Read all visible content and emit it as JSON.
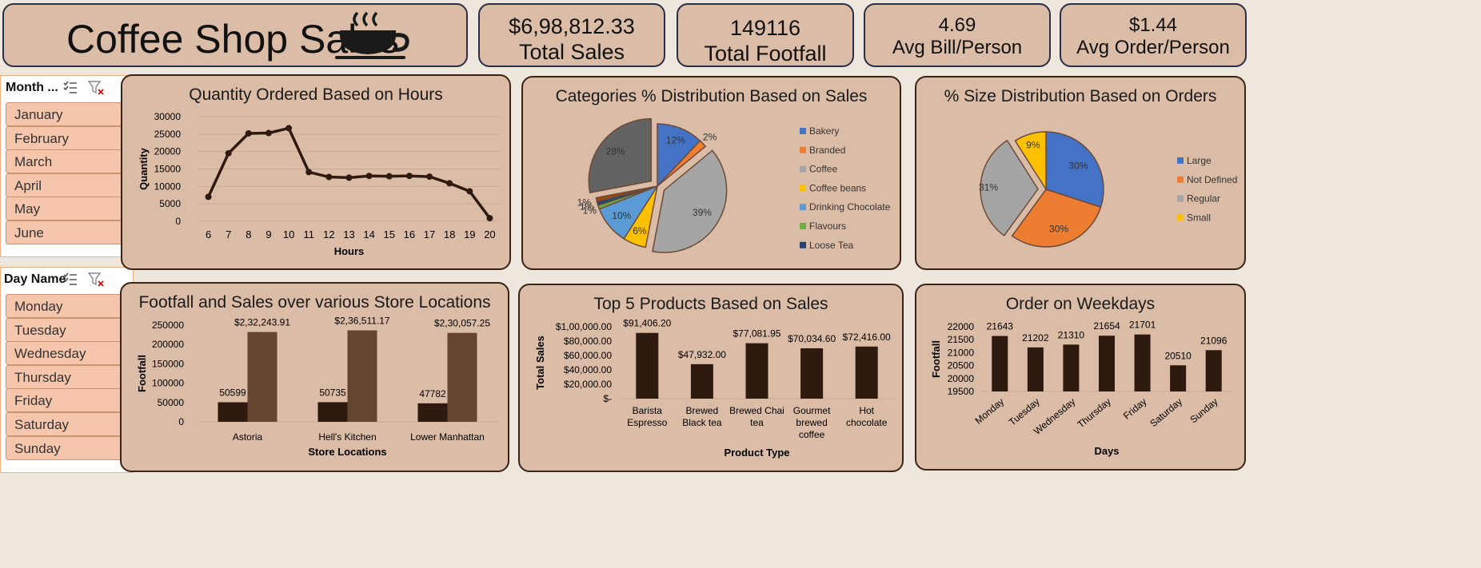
{
  "title": "Coffee Shop Sales",
  "kpis": [
    {
      "value": "$6,98,812.33",
      "label": "Total Sales"
    },
    {
      "value": "149116",
      "label": "Total Footfall"
    },
    {
      "value": "4.69",
      "label": "Avg Bill/Person"
    },
    {
      "value": "$1.44",
      "label": "Avg Order/Person"
    }
  ],
  "slicers": {
    "month": {
      "title": "Month ...",
      "items": [
        "January",
        "February",
        "March",
        "April",
        "May",
        "June"
      ]
    },
    "day": {
      "title": "Day Name",
      "items": [
        "Monday",
        "Tuesday",
        "Wednesday",
        "Thursday",
        "Friday",
        "Saturday",
        "Sunday"
      ]
    }
  },
  "colors": {
    "panel_bg": "#dbbca6",
    "dark_brown": "#2e1a0f",
    "mid_brown": "#634530",
    "line": "#2e1a0f"
  },
  "chart_data": [
    {
      "type": "line",
      "title": "Quantity Ordered Based on Hours",
      "xlabel": "Hours",
      "ylabel": "Quantity",
      "x": [
        6,
        7,
        8,
        9,
        10,
        11,
        12,
        13,
        14,
        15,
        16,
        17,
        18,
        19,
        20
      ],
      "values": [
        7000,
        19500,
        25200,
        25300,
        26700,
        14100,
        12700,
        12500,
        13000,
        12900,
        13000,
        12800,
        10900,
        8600,
        900
      ],
      "ylim": [
        0,
        30000
      ],
      "yticks": [
        "0",
        "5000",
        "10000",
        "15000",
        "20000",
        "25000",
        "30000"
      ],
      "grid": true
    },
    {
      "type": "pie",
      "title": "Categories % Distribution Based on Sales",
      "series": [
        {
          "name": "Bakery",
          "value": 12,
          "label": "12%",
          "color": "#4472c4"
        },
        {
          "name": "Branded",
          "value": 2,
          "label": "2%",
          "color": "#ed7d31"
        },
        {
          "name": "Coffee",
          "value": 39,
          "label": "39%",
          "color": "#a5a5a5"
        },
        {
          "name": "Coffee beans",
          "value": 6,
          "label": "6%",
          "color": "#ffc000"
        },
        {
          "name": "Drinking Chocolate",
          "value": 10,
          "label": "10%",
          "color": "#5b9bd5"
        },
        {
          "name": "Flavours",
          "value": 1,
          "label": "1%",
          "color": "#70ad47"
        },
        {
          "name": "Loose Tea",
          "value": 1,
          "label": "1%",
          "color": "#264478"
        },
        {
          "name": "",
          "value": 1,
          "label": "1%",
          "color": "#9e480e"
        },
        {
          "name": "",
          "value": 28,
          "label": "28%",
          "color": "#636363"
        }
      ],
      "legend": "right"
    },
    {
      "type": "pie",
      "title": "% Size Distribution Based on Orders",
      "series": [
        {
          "name": "Large",
          "value": 30,
          "label": "30%",
          "color": "#4472c4"
        },
        {
          "name": "Not Defined",
          "value": 30,
          "label": "30%",
          "color": "#ed7d31"
        },
        {
          "name": "Regular",
          "value": 31,
          "label": "31%",
          "color": "#a5a5a5"
        },
        {
          "name": "Small",
          "value": 9,
          "label": "9%",
          "color": "#ffc000"
        }
      ],
      "legend": "right"
    },
    {
      "type": "bar",
      "title": "Footfall and Sales over various Store Locations",
      "xlabel": "Store Locations",
      "ylabel": "Footfall",
      "categories": [
        "Astoria",
        "Hell's Kitchen",
        "Lower Manhattan"
      ],
      "series": [
        {
          "values": [
            50599,
            50735,
            47782
          ],
          "labels": [
            "50599",
            "50735",
            "47782"
          ]
        },
        {
          "values": [
            232243.91,
            236511.17,
            230057.25
          ],
          "labels": [
            "$2,32,243.91",
            "$2,36,511.17",
            "$2,30,057.25"
          ]
        }
      ],
      "ylim": [
        0,
        250000
      ],
      "yticks": [
        "0",
        "50000",
        "100000",
        "150000",
        "200000",
        "250000"
      ]
    },
    {
      "type": "bar",
      "title": "Top 5 Products Based on Sales",
      "xlabel": "Product Type",
      "ylabel": "Total Sales",
      "categories": [
        [
          "Barista",
          "Espresso"
        ],
        [
          "Brewed",
          "Black tea"
        ],
        [
          "Brewed Chai",
          "tea"
        ],
        [
          "Gourmet",
          "brewed",
          "coffee"
        ],
        [
          "Hot",
          "chocolate"
        ]
      ],
      "values": [
        91406.2,
        47932.0,
        77081.95,
        70034.6,
        72416.0
      ],
      "value_labels": [
        "$91,406.20",
        "$47,932.00",
        "$77,081.95",
        "$70,034.60",
        "$72,416.00"
      ],
      "ylim": [
        0,
        100000
      ],
      "yticks": [
        "$-",
        "$20,000.00",
        "$40,000.00",
        "$60,000.00",
        "$80,000.00",
        "$1,00,000.00"
      ]
    },
    {
      "type": "bar",
      "title": "Order on Weekdays",
      "xlabel": "Days",
      "ylabel": "Footfall",
      "categories": [
        "Monday",
        "Tuesday",
        "Wednesday",
        "Thursday",
        "Friday",
        "Saturday",
        "Sunday"
      ],
      "values": [
        21643,
        21202,
        21310,
        21654,
        21701,
        20510,
        21096
      ],
      "value_labels": [
        "21643",
        "21202",
        "21310",
        "21654",
        "21701",
        "20510",
        "21096"
      ],
      "ylim": [
        19500,
        22000
      ],
      "yticks": [
        "19500",
        "20000",
        "20500",
        "21000",
        "21500",
        "22000"
      ]
    }
  ]
}
